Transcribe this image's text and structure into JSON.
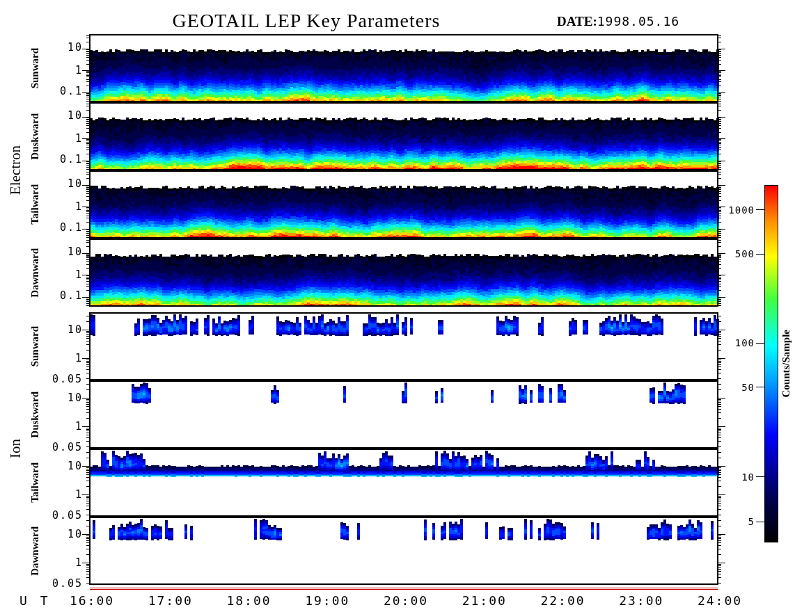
{
  "title": "GEOTAIL LEP Key Parameters",
  "date": {
    "label": "DATE:",
    "value": "1998.05.16"
  },
  "groups": [
    {
      "species": "Electron",
      "kind": "electron",
      "panels": [
        {
          "direction": "Sunward",
          "yticks": [
            "10",
            "1",
            "0.1"
          ]
        },
        {
          "direction": "Duskward",
          "yticks": [
            "10",
            "1",
            "0.1"
          ]
        },
        {
          "direction": "Tailward",
          "yticks": [
            "10",
            "1",
            "0.1"
          ]
        },
        {
          "direction": "Dawnward",
          "yticks": [
            "10",
            "1",
            "0.1"
          ]
        }
      ]
    },
    {
      "species": "Ion",
      "kind": "ion",
      "panels": [
        {
          "direction": "Sunward",
          "yticks": [
            "10",
            "1",
            "0.05"
          ]
        },
        {
          "direction": "Duskward",
          "yticks": [
            "10",
            "1",
            "0.05"
          ]
        },
        {
          "direction": "Tailward",
          "yticks": [
            "10",
            "1",
            "0.05"
          ]
        },
        {
          "direction": "Dawnward",
          "yticks": [
            "10",
            "1",
            "0.05"
          ]
        }
      ]
    }
  ],
  "time_axis": {
    "label": "U T",
    "ticks": [
      "16:00",
      "17:00",
      "18:00",
      "19:00",
      "20:00",
      "21:00",
      "22:00",
      "23:00",
      "24:00"
    ]
  },
  "colorbar": {
    "label": "Counts/Sample",
    "ticks": [
      "1000",
      "500",
      "100",
      "50",
      "10",
      "5"
    ]
  }
}
